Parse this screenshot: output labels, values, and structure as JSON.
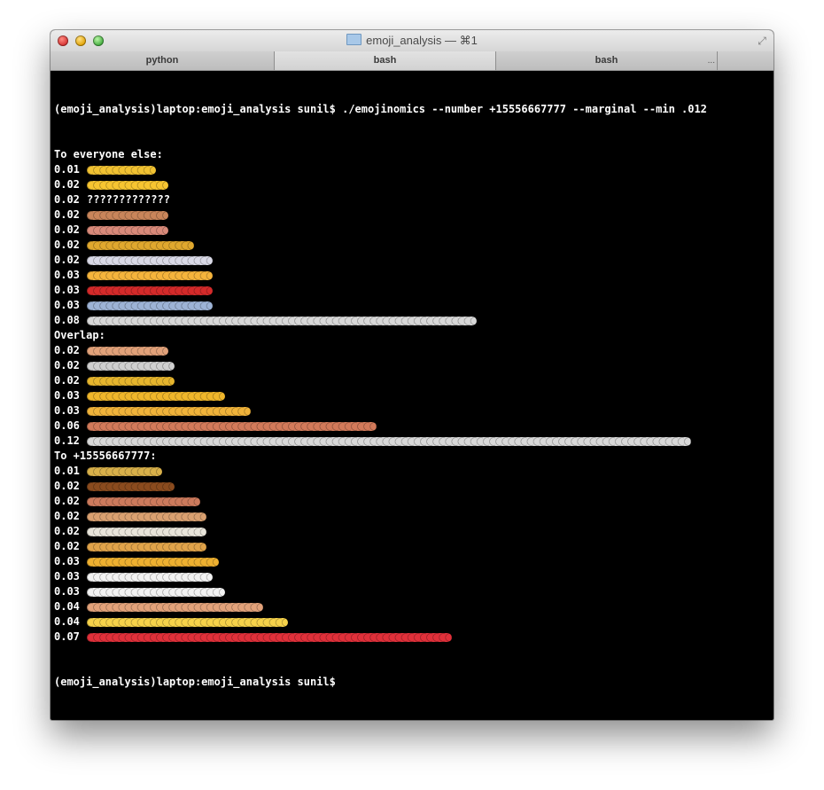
{
  "window": {
    "title": "emoji_analysis — ⌘1",
    "tabs": [
      {
        "label": "python",
        "active": false
      },
      {
        "label": "bash",
        "active": true
      },
      {
        "label": "bash",
        "active": false
      }
    ],
    "tab_overflow": "..."
  },
  "terminal": {
    "command_line": "(emoji_analysis)laptop:emoji_analysis sunil$ ./emojinomics --number +15556667777 --marginal --min .012",
    "final_prompt": "(emoji_analysis)laptop:emoji_analysis sunil$",
    "sections": [
      {
        "heading": "To everyone else:",
        "rows": [
          {
            "value": "0.01",
            "count": 11,
            "icon": "beaming-face-emoji",
            "color": "#f1c232"
          },
          {
            "value": "0.02",
            "count": 13,
            "icon": "smiling-face-emoji",
            "color": "#f7c531"
          },
          {
            "value": "0.02",
            "count": 13,
            "icon": "question-mark",
            "text": "?????????????",
            "color": "#ffffff"
          },
          {
            "value": "0.02",
            "count": 13,
            "icon": "pizza-emoji",
            "color": "#c9855a"
          },
          {
            "value": "0.02",
            "count": 13,
            "icon": "person-emoji",
            "color": "#d98a7a"
          },
          {
            "value": "0.02",
            "count": 17,
            "icon": "grinning-cat-emoji",
            "color": "#e0a82e"
          },
          {
            "value": "0.02",
            "count": 20,
            "icon": "ghost-emoji",
            "color": "#d9d9e6"
          },
          {
            "value": "0.03",
            "count": 20,
            "icon": "grinning-face-emoji",
            "color": "#f5b43c"
          },
          {
            "value": "0.03",
            "count": 20,
            "icon": "red-heart-emoji",
            "color": "#d42a2a"
          },
          {
            "value": "0.03",
            "count": 20,
            "icon": "sparkles-emoji",
            "color": "#9db3d6"
          },
          {
            "value": "0.08",
            "count": 62,
            "icon": "snowflake-emoji",
            "color": "#d8d8d8"
          }
        ]
      },
      {
        "heading": "Overlap:",
        "rows": [
          {
            "value": "0.02",
            "count": 13,
            "icon": "thumbs-up-emoji",
            "color": "#e2a27a"
          },
          {
            "value": "0.02",
            "count": 14,
            "icon": "skull-emoji",
            "color": "#cfcfcf"
          },
          {
            "value": "0.02",
            "count": 14,
            "icon": "smirking-face-emoji",
            "color": "#e6b52d"
          },
          {
            "value": "0.03",
            "count": 22,
            "icon": "laughing-face-emoji",
            "color": "#efb62b"
          },
          {
            "value": "0.03",
            "count": 26,
            "icon": "winking-face-emoji",
            "color": "#f0b33a"
          },
          {
            "value": "0.06",
            "count": 46,
            "icon": "woman-face-emoji",
            "color": "#d27a5a"
          },
          {
            "value": "0.12",
            "count": 96,
            "icon": "snowflake-emoji",
            "color": "#d8d8d8"
          }
        ]
      },
      {
        "heading": "To +15556667777:",
        "rows": [
          {
            "value": "0.01",
            "count": 12,
            "icon": "happy-face-emoji",
            "color": "#d8b04a"
          },
          {
            "value": "0.02",
            "count": 14,
            "icon": "poop-emoji",
            "color": "#8a4b1e"
          },
          {
            "value": "0.02",
            "count": 18,
            "icon": "girl-face-emoji",
            "color": "#cc7a5c"
          },
          {
            "value": "0.02",
            "count": 19,
            "icon": "hands-emoji",
            "color": "#d9a070"
          },
          {
            "value": "0.02",
            "count": 19,
            "icon": "eyeballs-emoji",
            "color": "#e8e4da"
          },
          {
            "value": "0.02",
            "count": 19,
            "icon": "cat-face-emoji",
            "color": "#e0a34a"
          },
          {
            "value": "0.03",
            "count": 21,
            "icon": "grinning-smile-emoji",
            "color": "#eeb030"
          },
          {
            "value": "0.03",
            "count": 20,
            "icon": "white-heart-glyph",
            "color": "#f2f2f2"
          },
          {
            "value": "0.03",
            "count": 22,
            "icon": "right-arrow-glyph",
            "color": "#f2f2f2"
          },
          {
            "value": "0.04",
            "count": 28,
            "icon": "thumbs-up-emoji",
            "color": "#e2a27a"
          },
          {
            "value": "0.04",
            "count": 32,
            "icon": "star-emoji",
            "color": "#f6d24a"
          },
          {
            "value": "0.07",
            "count": 58,
            "icon": "red-heart-emoji",
            "color": "#e0303a"
          }
        ]
      }
    ]
  }
}
